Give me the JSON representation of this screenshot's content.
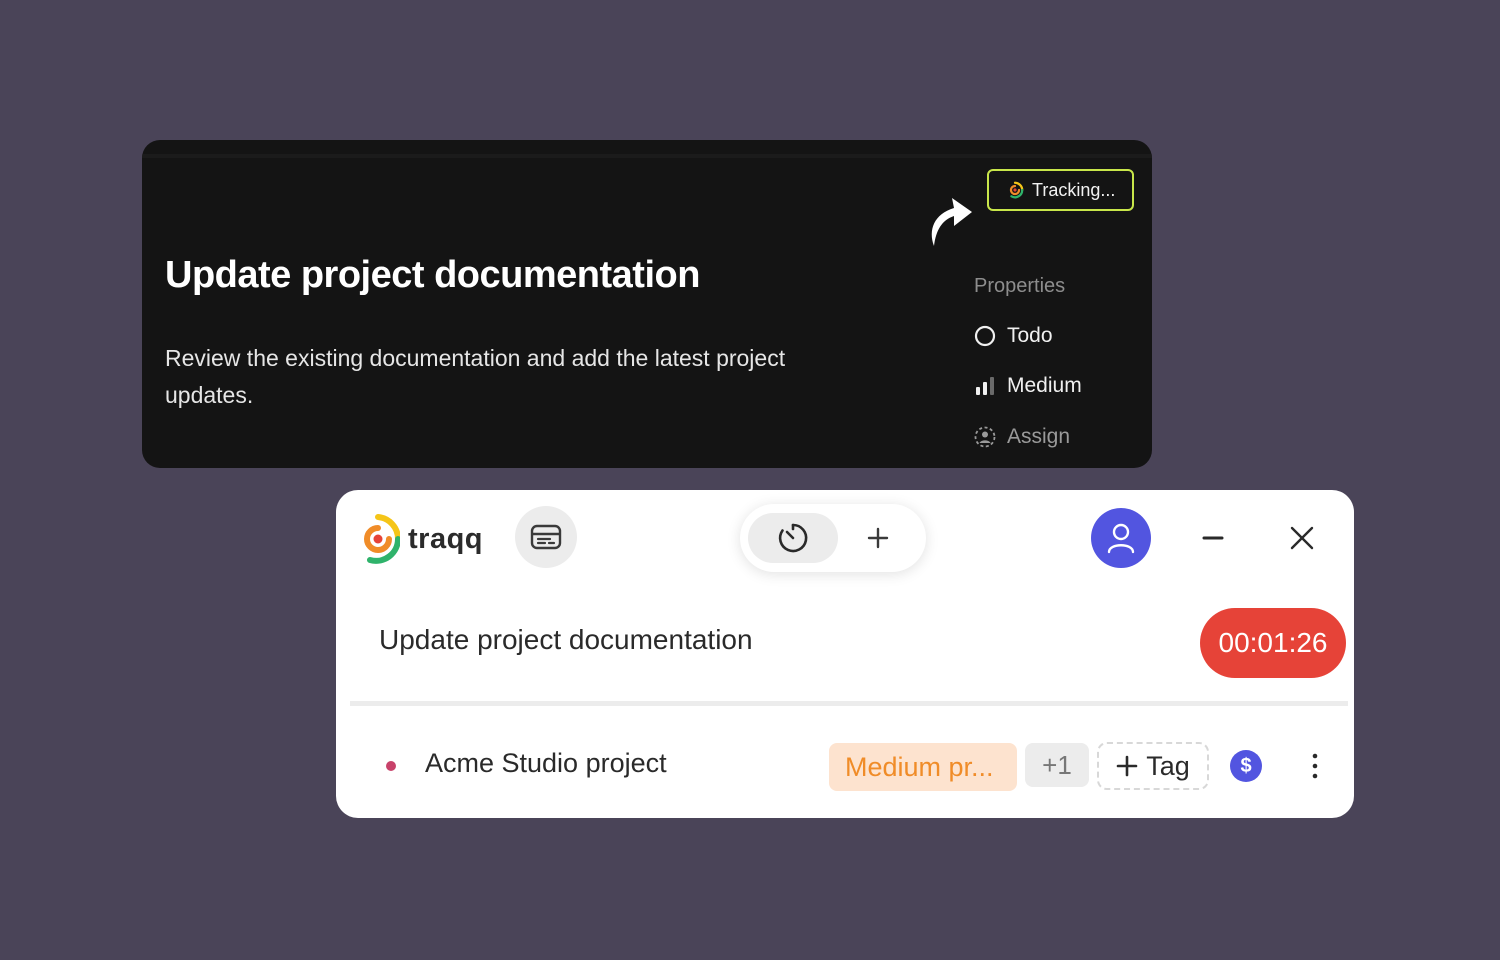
{
  "task_card": {
    "title": "Update project documentation",
    "description": "Review the existing documentation and add the latest project updates.",
    "tracking_button": "Tracking...",
    "properties": {
      "heading": "Properties",
      "status": "Todo",
      "priority": "Medium",
      "assignee": "Assign"
    }
  },
  "widget": {
    "logo_text": "traqq",
    "task_title": "Update project documentation",
    "timer": "00:01:26",
    "project": {
      "name": "Acme Studio project",
      "dot_color": "#c8426a"
    },
    "tags": {
      "priority_tag": "Medium pr...",
      "more_count": "+1",
      "add_label": "Tag"
    },
    "billable_symbol": "$"
  },
  "colors": {
    "background": "#4a4458",
    "tracking_border": "#c8e64a",
    "timer_red": "#e64338",
    "accent_blue": "#5255e0",
    "priority_tag_bg": "#fde3cf",
    "priority_tag_text": "#f08c28"
  },
  "icons": {
    "tracking": "traqq-logo-icon",
    "arrow": "curved-arrow-icon",
    "status": "circle-icon",
    "priority": "signal-bars-icon",
    "assign": "user-dashed-icon",
    "card_view": "card-icon",
    "timer": "stopwatch-icon",
    "add": "plus-icon",
    "avatar": "user-icon",
    "minimize": "minus-icon",
    "close": "close-icon",
    "billable": "dollar-icon",
    "more": "more-vertical-icon"
  }
}
